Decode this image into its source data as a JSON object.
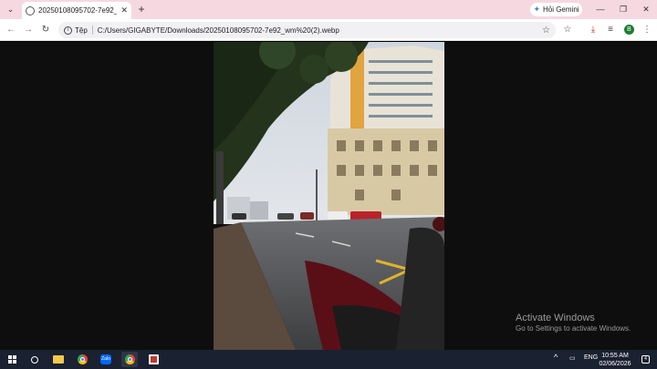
{
  "browser": {
    "tab_title": "20250108095702-7e92_wm (2).webp",
    "tab_close": "✕",
    "new_tab": "+",
    "gemini_label": "Hỏi Gemini",
    "window_minimize": "—",
    "window_restore": "❐",
    "window_close": "✕"
  },
  "toolbar": {
    "back": "←",
    "forward": "→",
    "reload": "↻",
    "site_chip": "Tệp",
    "url": "C:/Users/GIGABYTE/Downloads/20250108095702-7e92_wm%20(2).webp",
    "profile_initial": "B"
  },
  "watermark": {
    "title": "Activate Windows",
    "subtitle": "Go to Settings to activate Windows."
  },
  "taskbar": {
    "zalo_label": "Zalo",
    "language": "ENG",
    "time": "10:55 AM",
    "date": "02/06/2026",
    "notification_count": "4"
  },
  "colors": {
    "tabstrip": "#f6d8e1",
    "taskbar": "#1a2130",
    "viewer_bg": "#0e0e0e"
  }
}
